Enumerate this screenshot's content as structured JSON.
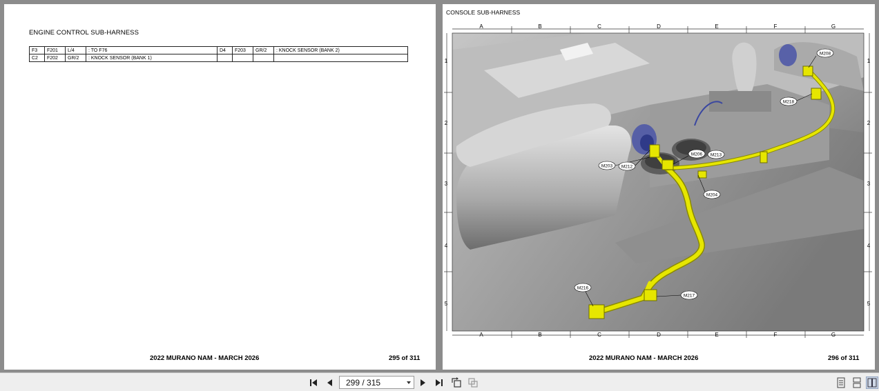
{
  "left_page": {
    "title": "ENGINE CONTROL SUB-HARNESS",
    "connector_rows": [
      {
        "grid_a": "F3",
        "conn_a": "F201",
        "color_a": "L/4",
        "desc_a": ": TO F76",
        "grid_b": "D4",
        "conn_b": "F203",
        "color_b": "GR/2",
        "desc_b": ": KNOCK SENSOR (BANK 2)"
      },
      {
        "grid_a": "C2",
        "conn_a": "F202",
        "color_a": "GR/2",
        "desc_a": ": KNOCK SENSOR (BANK 1)",
        "grid_b": "",
        "conn_b": "",
        "color_b": "",
        "desc_b": ""
      }
    ],
    "footer_title": "2022 MURANO NAM - MARCH 2026",
    "footer_page": "295 of 311"
  },
  "right_page": {
    "title": "CONSOLE SUB-HARNESS",
    "grid_columns": [
      "A",
      "B",
      "C",
      "D",
      "E",
      "F",
      "G"
    ],
    "grid_rows": [
      "1",
      "2",
      "3",
      "4",
      "5"
    ],
    "connectors": [
      "M208",
      "M218",
      "M206",
      "M213",
      "M203",
      "M212",
      "M204",
      "M216",
      "M217"
    ],
    "harness_color": "#e6e600",
    "footer_title": "2022 MURANO NAM - MARCH 2026",
    "footer_page": "296 of 311"
  },
  "toolbar": {
    "page_indicator": "299 / 315",
    "icons": [
      "first-page-icon",
      "previous-page-icon",
      "next-page-icon",
      "last-page-icon",
      "rotate-page-icon",
      "fit-page-icon",
      "single-page-view-icon",
      "continuous-view-icon",
      "two-page-view-icon"
    ]
  }
}
